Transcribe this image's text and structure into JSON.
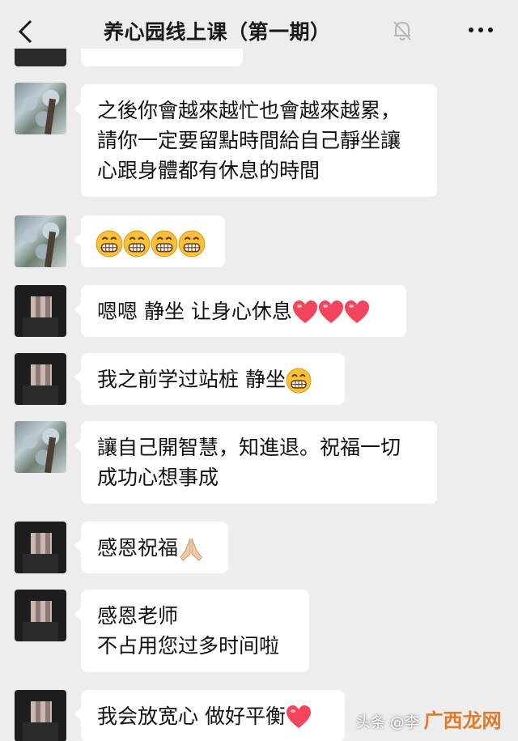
{
  "header": {
    "title": "养心园线上课（第一期）",
    "back_icon": "chevron-left-icon",
    "mute_icon": "bell-off-icon",
    "more_icon": "more-dots-icon"
  },
  "messages": [
    {
      "sender": "tree",
      "text_lines": [
        "之後你會越來越忙也會越來越累，",
        "請你一定要留點時間給自己靜坐讓",
        "心跟身體都有休息的時間"
      ]
    },
    {
      "sender": "tree",
      "emojis": [
        "grin-emoji",
        "grin-emoji",
        "grin-emoji",
        "grin-emoji"
      ]
    },
    {
      "sender": "dark",
      "text": "嗯嗯 静坐 让身心休息",
      "emojis": [
        "heart-emoji",
        "heart-emoji",
        "heart-emoji"
      ]
    },
    {
      "sender": "dark",
      "text": "我之前学过站桩 静坐",
      "emojis": [
        "grin-emoji"
      ]
    },
    {
      "sender": "tree",
      "text_lines": [
        "讓自己開智慧，知進退。祝福一切",
        "成功心想事成"
      ]
    },
    {
      "sender": "dark",
      "text": "感恩祝福",
      "emojis": [
        "pray-emoji"
      ]
    },
    {
      "sender": "dark",
      "text_lines": [
        "感恩老师",
        "不占用您过多时间啦"
      ]
    },
    {
      "sender": "dark",
      "text": "我会放宽心 做好平衡",
      "emojis": [
        "heart-emoji"
      ]
    }
  ],
  "watermark": {
    "prefix": "头条 @李",
    "logo": "广西龙网"
  },
  "colors": {
    "background": "#ededed",
    "bubble": "#ffffff",
    "heart": "#f2455c",
    "grin": "#f7c13a"
  }
}
